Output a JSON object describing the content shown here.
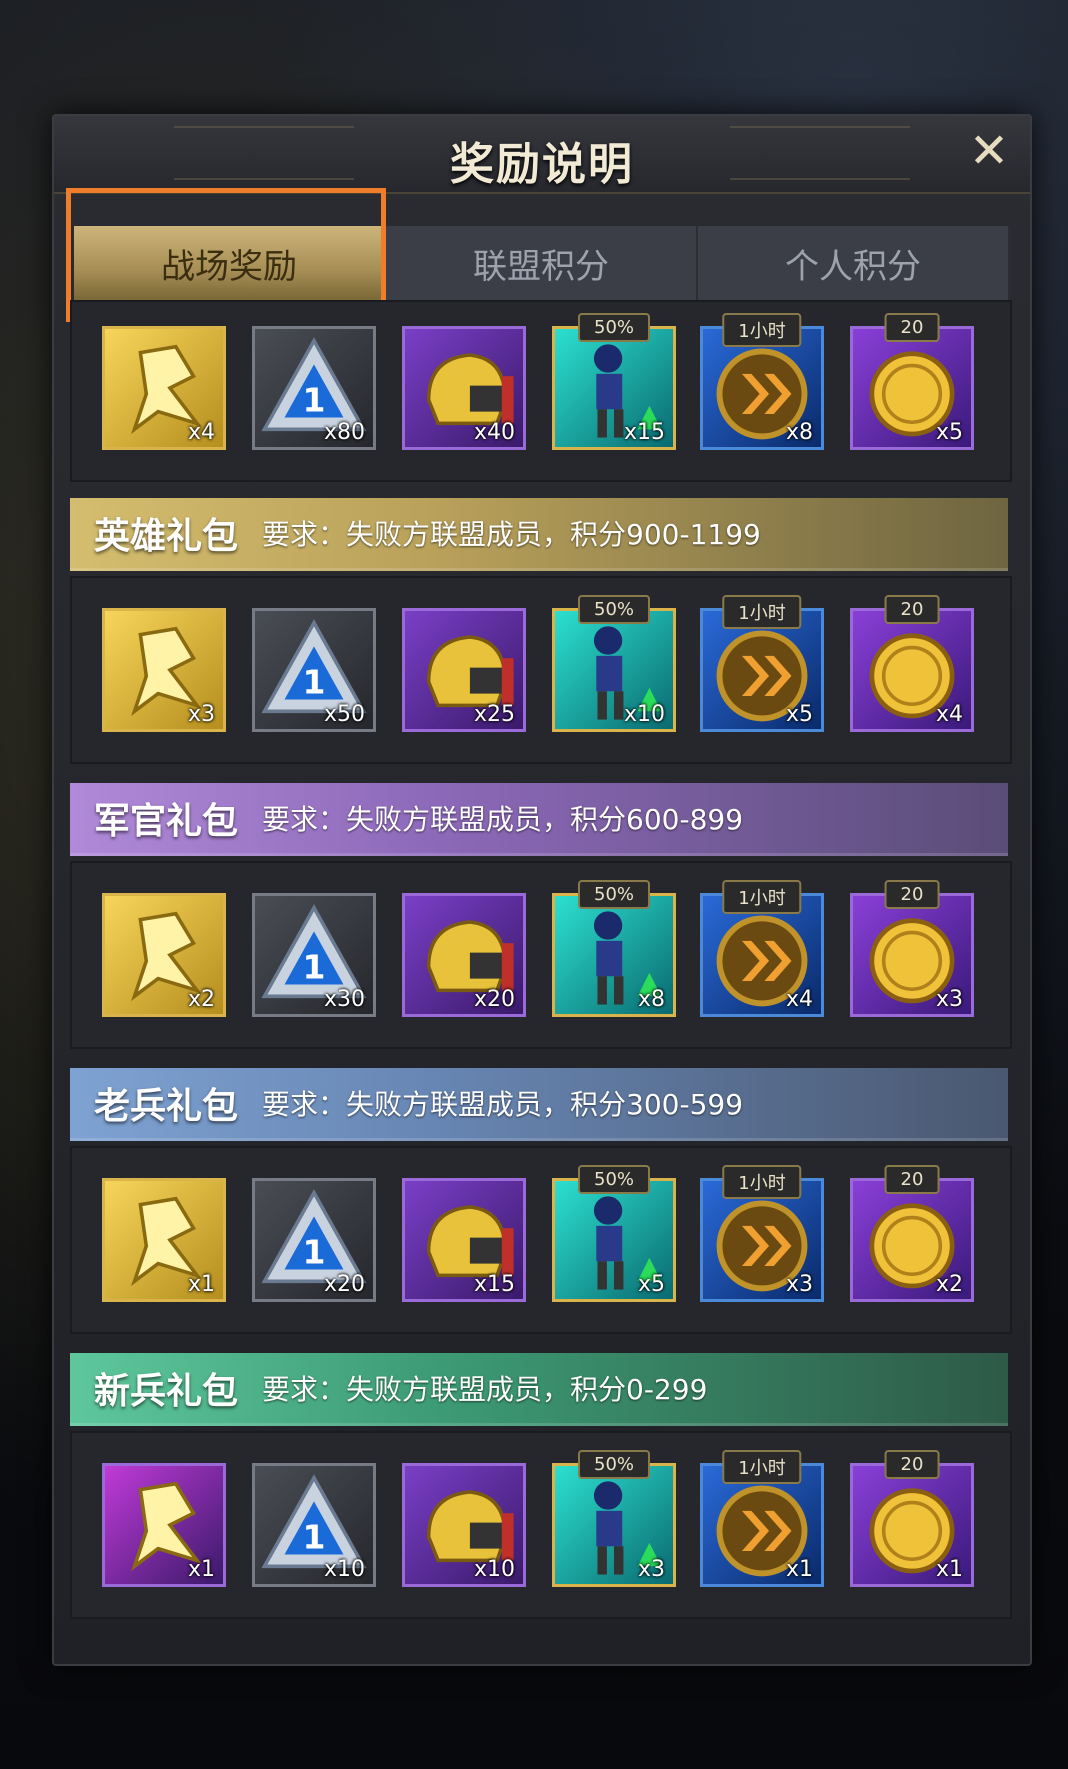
{
  "dialog": {
    "title": "奖励说明",
    "close_symbol": "✕"
  },
  "tabs": [
    {
      "label": "战场奖励",
      "active": true
    },
    {
      "label": "联盟积分",
      "active": false
    },
    {
      "label": "个人积分",
      "active": false
    }
  ],
  "item_types": [
    {
      "icon": "gold-medal-icon",
      "color": "gold"
    },
    {
      "icon": "blue-triangle-chip-icon",
      "color": "silver"
    },
    {
      "icon": "golden-helmet-icon",
      "color": "purple"
    },
    {
      "icon": "soldier-icon",
      "color": "cyan",
      "tag": "50%"
    },
    {
      "icon": "speed-up-arrow-icon",
      "color": "blue",
      "tag": "1小时"
    },
    {
      "icon": "gold-coin-icon",
      "color": "violet",
      "tag": "20"
    }
  ],
  "top_row": {
    "counts": [
      "x4",
      "x80",
      "x40",
      "x15",
      "x8",
      "x5"
    ]
  },
  "packs": [
    {
      "name": "英雄礼包",
      "requirement": "要求：失败方联盟成员，积分900-1199",
      "color": "gold",
      "counts": [
        "x3",
        "x50",
        "x25",
        "x10",
        "x5",
        "x4"
      ]
    },
    {
      "name": "军官礼包",
      "requirement": "要求：失败方联盟成员，积分600-899",
      "color": "purple",
      "counts": [
        "x2",
        "x30",
        "x20",
        "x8",
        "x4",
        "x3"
      ]
    },
    {
      "name": "老兵礼包",
      "requirement": "要求：失败方联盟成员，积分300-599",
      "color": "blue",
      "counts": [
        "x1",
        "x20",
        "x15",
        "x5",
        "x3",
        "x2"
      ]
    },
    {
      "name": "新兵礼包",
      "requirement": "要求：失败方联盟成员，积分0-299",
      "color": "green",
      "counts": [
        "x1",
        "x10",
        "x10",
        "x3",
        "x1",
        "x1"
      ]
    }
  ],
  "colors": {
    "highlight_border": "#f07d2a",
    "first_item_new_recruit": "magenta"
  }
}
